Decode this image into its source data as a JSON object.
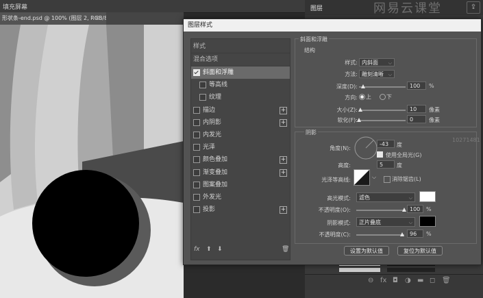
{
  "app": {
    "top_label": "填充屏幕",
    "doc_tab": "形状条-end.psd @ 100% (图层 2, RGB/8#) *",
    "close_glyph": "×"
  },
  "right_panel": {
    "label": "图层",
    "watermark": "网易云课堂",
    "share_glyph": "⇪",
    "bottom_icons": [
      "⊖",
      "fx",
      "◘",
      "◑",
      "▬",
      "◻",
      "🗑"
    ]
  },
  "side_watermark": "10271481",
  "dialog": {
    "title": "图层样式",
    "styles_header": "样式",
    "blend_header": "混合选项",
    "items": [
      {
        "label": "斜面和浮雕",
        "checked": true,
        "selected": true,
        "indent": false,
        "plus": false
      },
      {
        "label": "等高线",
        "checked": false,
        "selected": false,
        "indent": true,
        "plus": false
      },
      {
        "label": "纹理",
        "checked": false,
        "selected": false,
        "indent": true,
        "plus": false
      },
      {
        "label": "描边",
        "checked": false,
        "selected": false,
        "indent": false,
        "plus": true
      },
      {
        "label": "内阴影",
        "checked": false,
        "selected": false,
        "indent": false,
        "plus": true
      },
      {
        "label": "内发光",
        "checked": false,
        "selected": false,
        "indent": false,
        "plus": false
      },
      {
        "label": "光泽",
        "checked": false,
        "selected": false,
        "indent": false,
        "plus": false
      },
      {
        "label": "颜色叠加",
        "checked": false,
        "selected": false,
        "indent": false,
        "plus": true
      },
      {
        "label": "渐变叠加",
        "checked": false,
        "selected": false,
        "indent": false,
        "plus": true
      },
      {
        "label": "图案叠加",
        "checked": false,
        "selected": false,
        "indent": false,
        "plus": false
      },
      {
        "label": "外发光",
        "checked": false,
        "selected": false,
        "indent": false,
        "plus": false
      },
      {
        "label": "投影",
        "checked": false,
        "selected": false,
        "indent": false,
        "plus": true
      }
    ],
    "footer": {
      "fx": "fx",
      "up": "⬆",
      "down": "⬇",
      "trash": "🗑"
    },
    "bevel": {
      "section_title": "斜面和浮雕",
      "structure_title": "结构",
      "style_label": "样式:",
      "style_value": "内斜面",
      "method_label": "方法:",
      "method_value": "雕刻清晰",
      "depth_label": "深度(D):",
      "depth_value": "100",
      "depth_fraction": 0.1,
      "depth_unit": "%",
      "direction_label": "方向:",
      "dir_up": "上",
      "dir_down": "下",
      "size_label": "大小(Z):",
      "size_value": "10",
      "size_fraction": 0.04,
      "size_unit": "像素",
      "soften_label": "软化(F):",
      "soften_value": "0",
      "soften_fraction": 0,
      "soften_unit": "像素"
    },
    "shading": {
      "title": "阴影",
      "angle_label": "角度(N):",
      "angle_value": "-43",
      "angle_unit": "度",
      "global_light_label": "使用全局光(G)",
      "altitude_label": "高度:",
      "altitude_value": "5",
      "altitude_unit": "度",
      "gloss_label": "光泽等高线:",
      "antialias_label": "消除锯齿(L)",
      "highlight_label": "高光模式:",
      "highlight_value": "滤色",
      "highlight_color": "#ffffff",
      "opacity1_label": "不透明度(O):",
      "opacity1_value": "100",
      "opacity1_fraction": 1.0,
      "shadow_label": "阴影模式:",
      "shadow_value": "正片叠底",
      "shadow_color": "#000000",
      "opacity2_label": "不透明度(C):",
      "opacity2_value": "96",
      "opacity2_fraction": 0.96,
      "pct": "%"
    },
    "buttons": {
      "make_default": "设置为默认值",
      "reset_default": "复位为默认值"
    }
  }
}
